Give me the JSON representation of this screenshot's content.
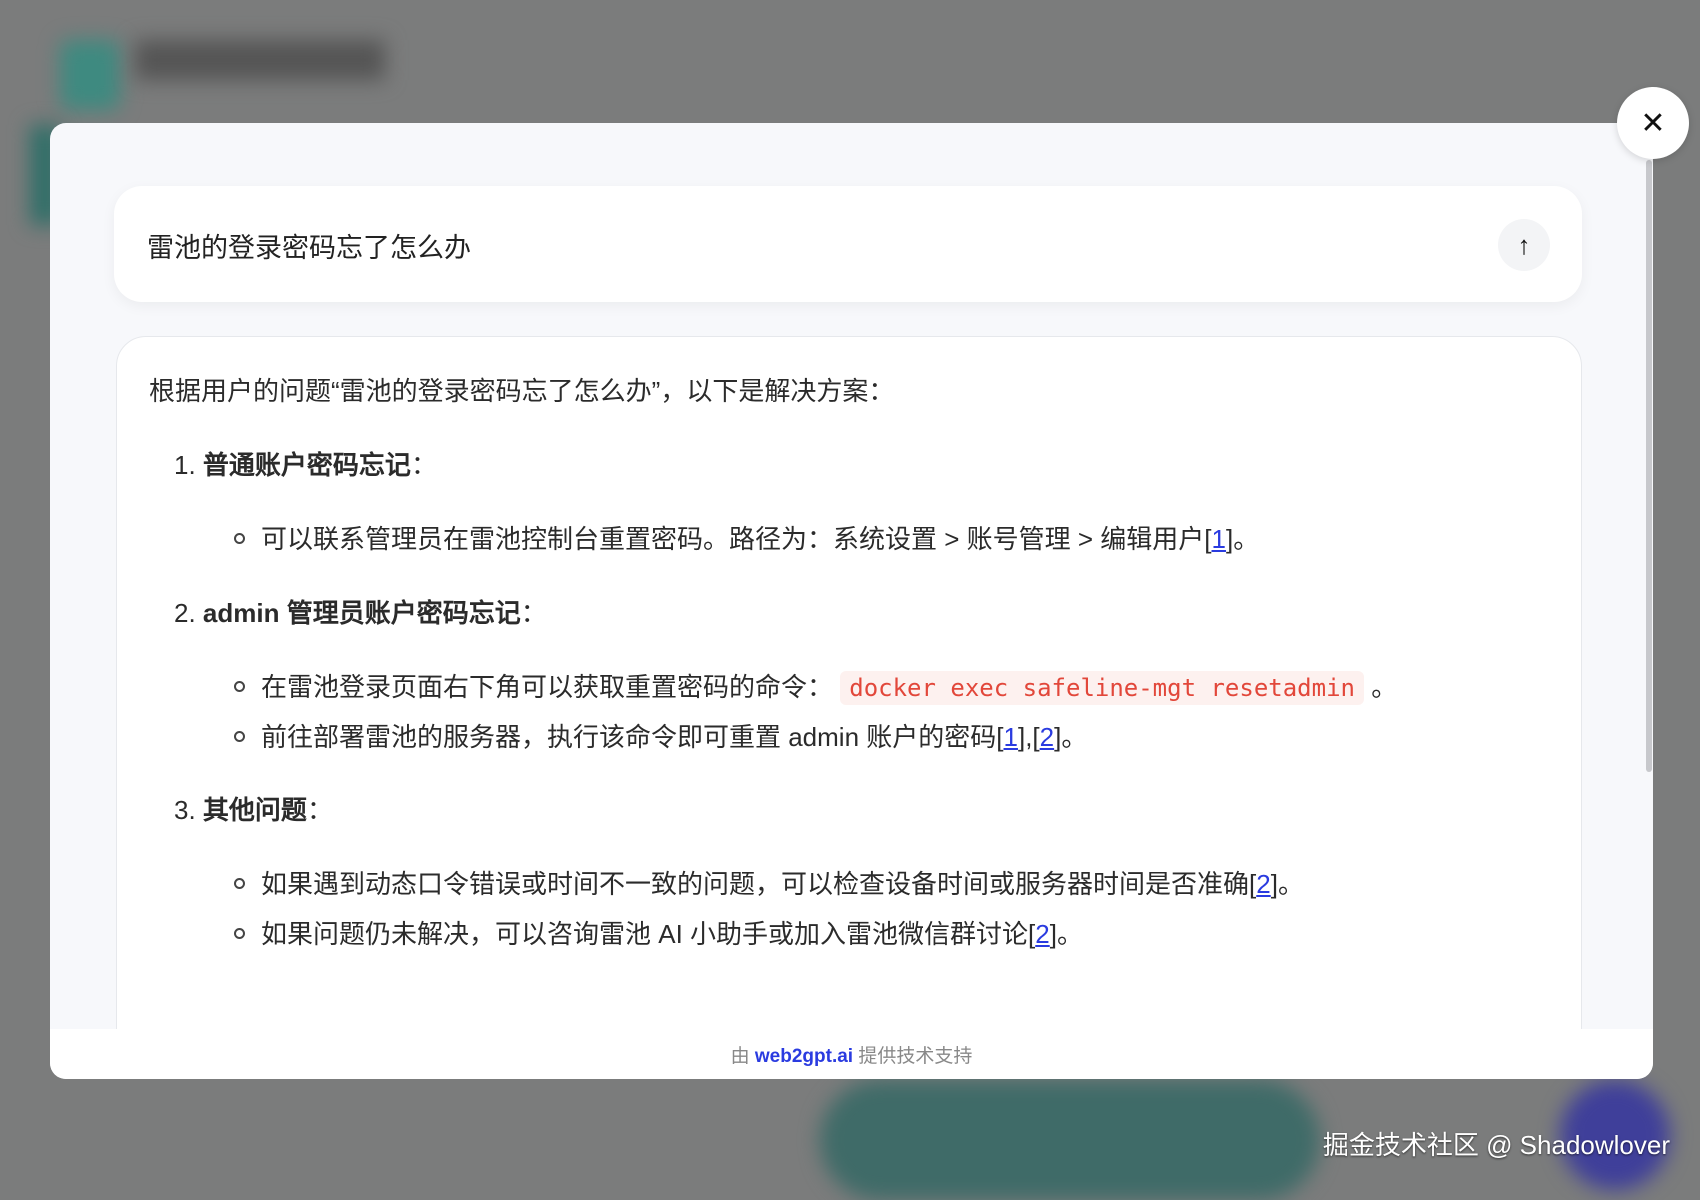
{
  "search": {
    "query": "雷池的登录密码忘了怎么办",
    "send_icon": "arrow-up"
  },
  "answer": {
    "intro": "根据用户的问题“雷池的登录密码忘了怎么办”，以下是解决方案：",
    "sections": [
      {
        "num": "1.",
        "title": "普通账户密码忘记",
        "suffix": "：",
        "bullets": [
          {
            "text": "可以联系管理员在雷池控制台重置密码。路径为：系统设置 > 账号管理 > 编辑用户",
            "refs": [
              "1"
            ],
            "end": "。"
          }
        ]
      },
      {
        "num": "2.",
        "title": "admin 管理员账户密码忘记",
        "suffix": "：",
        "bullets": [
          {
            "text": "在雷池登录页面右下角可以获取重置密码的命令：",
            "code": "docker exec safeline-mgt resetadmin",
            "end": "。"
          },
          {
            "text": "前往部署雷池的服务器，执行该命令即可重置 admin 账户的密码",
            "refs": [
              "1",
              "2"
            ],
            "end": "。"
          }
        ]
      },
      {
        "num": "3.",
        "title": "其他问题",
        "suffix": "：",
        "bullets": [
          {
            "text": "如果遇到动态口令错误或时间不一致的问题，可以检查设备时间或服务器时间是否准确",
            "refs": [
              "2"
            ],
            "end": "。"
          },
          {
            "text": "如果问题仍未解决，可以咨询雷池 AI 小助手或加入雷池微信群讨论",
            "refs": [
              "2"
            ],
            "end": "。"
          }
        ]
      }
    ]
  },
  "footer": {
    "prefix": "由",
    "brand": "web2gpt.ai",
    "suffix": "提供技术支持"
  },
  "watermark": "掘金技术社区 @ Shadowlover",
  "colors": {
    "link": "#2a3be0",
    "code": "#e2473a",
    "overlay": "#7b7c7c"
  }
}
